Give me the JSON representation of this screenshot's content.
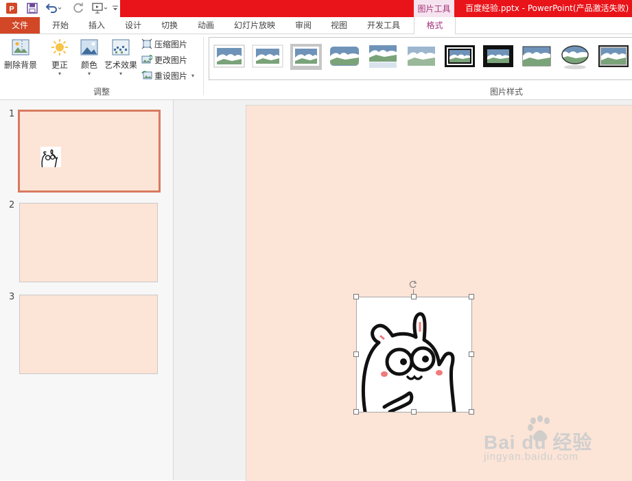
{
  "app": {
    "document_title": "百度经验.pptx - PowerPoint(产品激活失败)",
    "contextual_tab_label": "图片工具"
  },
  "quick_access": {
    "icons": [
      "powerpoint-logo-icon",
      "save-icon",
      "undo-icon",
      "redo-icon",
      "slideshow-from-beginning-icon",
      "customize-dropdown-icon"
    ]
  },
  "tabs": [
    "文件",
    "开始",
    "插入",
    "设计",
    "切换",
    "动画",
    "幻灯片放映",
    "审阅",
    "视图",
    "开发工具",
    "格式"
  ],
  "active_tab": "格式",
  "ribbon": {
    "remove_background": "删除背景",
    "corrections": "更正",
    "color": "颜色",
    "artistic_effects": "艺术效果",
    "compress_pictures": "压缩图片",
    "change_picture": "更改图片",
    "reset_picture": "重设图片",
    "adjust_group_label": "调整",
    "picture_styles_group_label": "图片样式"
  },
  "slides": [
    {
      "number": "1",
      "selected": true,
      "has_picture": true
    },
    {
      "number": "2",
      "selected": false,
      "has_picture": false
    },
    {
      "number": "3",
      "selected": false,
      "has_picture": false
    }
  ],
  "colors": {
    "file_tab": "#d24726",
    "title_bar": "#e8141a",
    "contextual_accent": "#a4327a",
    "slide_background": "#fce4d6"
  },
  "watermark": {
    "brand": "Bai du 经验",
    "url": "jingyan.baidu.com"
  }
}
